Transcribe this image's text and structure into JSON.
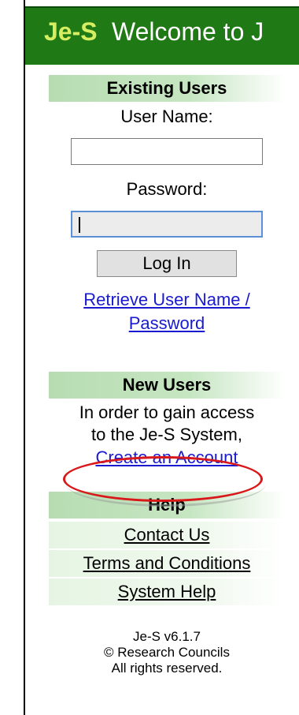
{
  "header": {
    "logo_text": "Je-S",
    "welcome_text": "Welcome to J"
  },
  "existing_users": {
    "title": "Existing Users",
    "username_label": "User Name:",
    "username_value": "",
    "password_label": "Password:",
    "password_value": "",
    "login_button": "Log In",
    "retrieve_link_line1": "Retrieve User Name /",
    "retrieve_link_line2": "Password"
  },
  "new_users": {
    "title": "New Users",
    "intro_line1": "In order to gain access",
    "intro_line2": "to the Je-S System,",
    "create_account_link": "Create an Account"
  },
  "help": {
    "title": "Help",
    "links": [
      "Contact Us",
      "Terms and Conditions",
      "System Help"
    ]
  },
  "footer": {
    "version": "Je-S v6.1.7",
    "copyright": "© Research Councils",
    "rights": "All rights reserved."
  },
  "colors": {
    "header_green": "#1f7a16",
    "logo_yellow": "#d8ee62",
    "section_green": "#b7dcb2",
    "link_blue": "#1a1ad0",
    "annotation_red": "#d8181a"
  }
}
